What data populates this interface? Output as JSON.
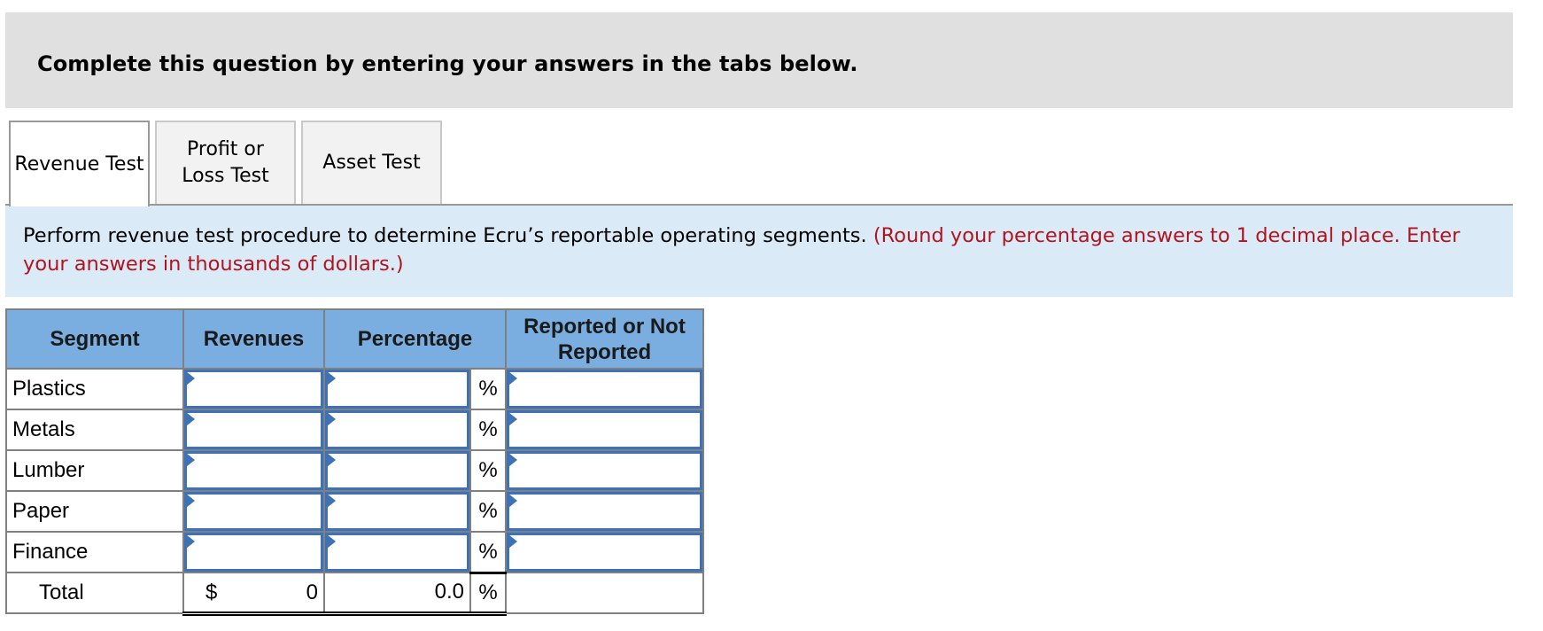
{
  "banner": {
    "text": "Complete this question by entering your answers in the tabs below."
  },
  "tabs": [
    {
      "label": "Revenue Test",
      "active": true
    },
    {
      "label": "Profit or Loss Test",
      "active": false
    },
    {
      "label": "Asset Test",
      "active": false
    }
  ],
  "instructions": {
    "text": "Perform revenue test procedure to determine Ecru’s reportable operating segments.",
    "note": "(Round your percentage answers to 1 decimal place. Enter your answers in thousands of dollars.)"
  },
  "table": {
    "headers": {
      "segment": "Segment",
      "revenues": "Revenues",
      "percentage": "Percentage",
      "reported": "Reported or Not Reported"
    },
    "percent_symbol": "%",
    "rows": [
      {
        "segment": "Plastics",
        "revenues": "",
        "percentage": "",
        "reported": ""
      },
      {
        "segment": "Metals",
        "revenues": "",
        "percentage": "",
        "reported": ""
      },
      {
        "segment": "Lumber",
        "revenues": "",
        "percentage": "",
        "reported": ""
      },
      {
        "segment": "Paper",
        "revenues": "",
        "percentage": "",
        "reported": ""
      },
      {
        "segment": "Finance",
        "revenues": "",
        "percentage": "",
        "reported": ""
      }
    ],
    "total": {
      "label": "Total",
      "currency": "$",
      "revenues": "0",
      "percentage": "0.0",
      "percent_symbol": "%"
    }
  },
  "colors": {
    "banner_bg": "#e0e0e0",
    "instructions_bg": "#dbeaf7",
    "note_red": "#b0141f",
    "header_blue": "#7aaee0",
    "input_border": "#3d73b6"
  }
}
